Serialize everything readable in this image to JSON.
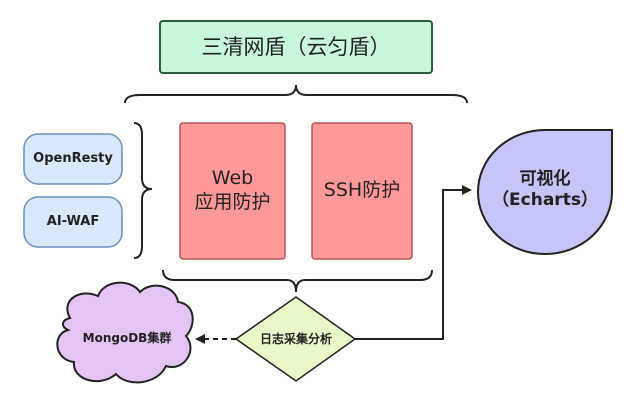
{
  "diagram": {
    "title": "三清网盾（云匀盾）",
    "left_modules": [
      "OpenResty",
      "AI-WAF"
    ],
    "protection_modules": [
      {
        "line1": "Web",
        "line2": "应用防护"
      },
      {
        "line1": "SSH防护",
        "line2": ""
      }
    ],
    "visualization": {
      "line1": "可视化",
      "line2": "（Echarts）"
    },
    "log_collection": "日志采集分析",
    "storage": "MongoDB集群"
  },
  "colors": {
    "title_fill": "#c9f7dc",
    "title_stroke": "#2e5d3e",
    "module_fill": "#dae8fc",
    "module_stroke": "#6c8ebf",
    "protection_fill": "#ff9999",
    "protection_stroke": "#b85450",
    "visualization_fill": "#c5c5f7",
    "log_fill": "#e8f8c8",
    "storage_fill": "#e4c4f4",
    "line": "#222222"
  }
}
